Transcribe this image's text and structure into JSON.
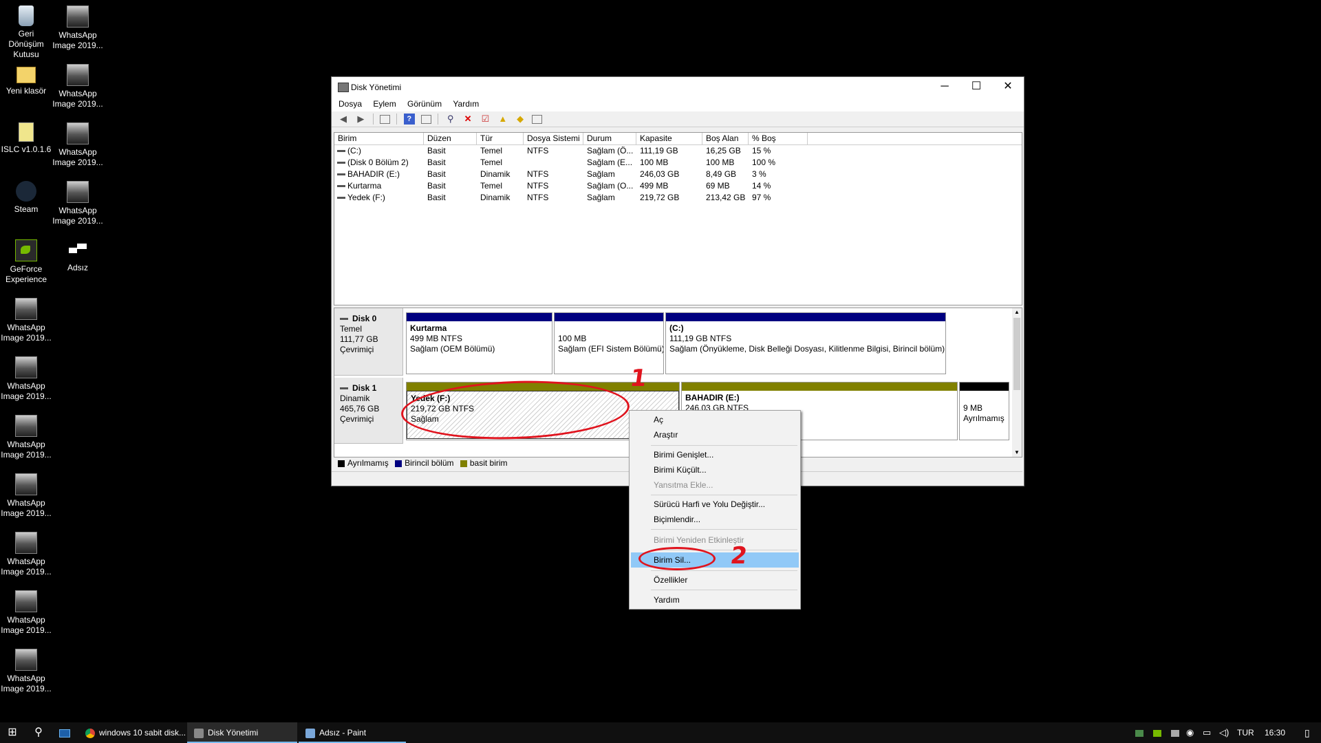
{
  "desktop": {
    "icons": [
      {
        "label": "Geri Dönüşüm Kutusu",
        "icon": "recycle-bin-icon"
      },
      {
        "label": "WhatsApp Image 2019...",
        "icon": "image-file-icon"
      },
      {
        "label": "Yeni klasör",
        "icon": "folder-icon"
      },
      {
        "label": "WhatsApp Image 2019...",
        "icon": "image-file-icon"
      },
      {
        "label": "ISLC v1.0.1.6",
        "icon": "app-icon"
      },
      {
        "label": "WhatsApp Image 2019...",
        "icon": "image-file-icon"
      },
      {
        "label": "Steam",
        "icon": "steam-icon"
      },
      {
        "label": "WhatsApp Image 2019...",
        "icon": "image-file-icon"
      },
      {
        "label": "GeForce Experience",
        "icon": "nvidia-icon"
      },
      {
        "label": "Adsız",
        "icon": "paint-file-icon"
      },
      {
        "label": "WhatsApp Image 2019...",
        "icon": "image-file-icon"
      },
      {
        "label": "WhatsApp Image 2019...",
        "icon": "image-file-icon"
      },
      {
        "label": "WhatsApp Image 2019...",
        "icon": "image-file-icon"
      },
      {
        "label": "WhatsApp Image 2019...",
        "icon": "image-file-icon"
      },
      {
        "label": "WhatsApp Image 2019...",
        "icon": "image-file-icon"
      },
      {
        "label": "WhatsApp Image 2019...",
        "icon": "image-file-icon"
      },
      {
        "label": "WhatsApp Image 2019...",
        "icon": "image-file-icon"
      }
    ]
  },
  "window": {
    "title": "Disk Yönetimi",
    "controls": {
      "minimize": "─",
      "maximize": "☐",
      "close": "✕"
    },
    "menu": [
      "Dosya",
      "Eylem",
      "Görünüm",
      "Yardım"
    ],
    "columns": [
      "Birim",
      "Düzen",
      "Tür",
      "Dosya Sistemi",
      "Durum",
      "Kapasite",
      "Boş Alan",
      "% Boş"
    ],
    "volumes": [
      [
        "(C:)",
        "Basit",
        "Temel",
        "NTFS",
        "Sağlam (Ö...",
        "111,19 GB",
        "16,25 GB",
        "15 %"
      ],
      [
        "(Disk 0 Bölüm 2)",
        "Basit",
        "Temel",
        "",
        "Sağlam (E...",
        "100 MB",
        "100 MB",
        "100 %"
      ],
      [
        "BAHADIR (E:)",
        "Basit",
        "Dinamik",
        "NTFS",
        "Sağlam",
        "246,03 GB",
        "8,49 GB",
        "3 %"
      ],
      [
        "Kurtarma",
        "Basit",
        "Temel",
        "NTFS",
        "Sağlam (O...",
        "499 MB",
        "69 MB",
        "14 %"
      ],
      [
        "Yedek (F:)",
        "Basit",
        "Dinamik",
        "NTFS",
        "Sağlam",
        "219,72 GB",
        "213,42 GB",
        "97 %"
      ]
    ],
    "disks": [
      {
        "name": "Disk 0",
        "type": "Temel",
        "size": "111,77 GB",
        "status": "Çevrimiçi",
        "partitions": [
          {
            "title": "Kurtarma",
            "line1": "499 MB NTFS",
            "line2": "Sağlam (OEM Bölümü)",
            "color": "#000080"
          },
          {
            "title": "",
            "line1": "100 MB",
            "line2": "Sağlam (EFI Sistem Bölümü)",
            "color": "#000080"
          },
          {
            "title": "(C:)",
            "line1": "111,19 GB NTFS",
            "line2": "Sağlam (Önyükleme, Disk Belleği Dosyası, Kilitlenme Bilgisi, Birincil bölüm)",
            "color": "#000080"
          }
        ]
      },
      {
        "name": "Disk 1",
        "type": "Dinamik",
        "size": "465,76 GB",
        "status": "Çevrimiçi",
        "partitions": [
          {
            "title": "Yedek  (F:)",
            "line1": "219,72 GB NTFS",
            "line2": "Sağlam",
            "color": "#808000"
          },
          {
            "title": "BAHADIR  (E:)",
            "line1": "246,03 GB NTFS",
            "line2": "",
            "color": "#808000"
          },
          {
            "title": "",
            "line1": "9 MB",
            "line2": "Ayrılmamış",
            "color": "#000000"
          }
        ]
      }
    ],
    "legend": [
      {
        "label": "Ayrılmamış",
        "color": "#000000"
      },
      {
        "label": "Birincil bölüm",
        "color": "#000080"
      },
      {
        "label": "basit birim",
        "color": "#808000"
      }
    ]
  },
  "context_menu": {
    "items": [
      "Aç",
      "Araştır",
      "Birimi Genişlet...",
      "Birimi Küçült...",
      "Yansıtma Ekle...",
      "Sürücü Harfi ve Yolu Değiştir...",
      "Biçimlendir...",
      "Birimi Yeniden Etkinleştir",
      "Birim Sil...",
      "Özellikler",
      "Yardım"
    ],
    "disabled": [
      "Yansıtma Ekle...",
      "Birimi Yeniden Etkinleştir"
    ],
    "highlighted": "Birim Sil..."
  },
  "annotations": {
    "step1": "1",
    "step2": "2",
    "color": "#e0141e"
  },
  "taskbar": {
    "buttons": [
      "windows 10 sabit disk...",
      "Disk Yönetimi",
      "Adsız - Paint"
    ],
    "active": "Disk Yönetimi",
    "language": "TUR",
    "time": "16:30"
  }
}
